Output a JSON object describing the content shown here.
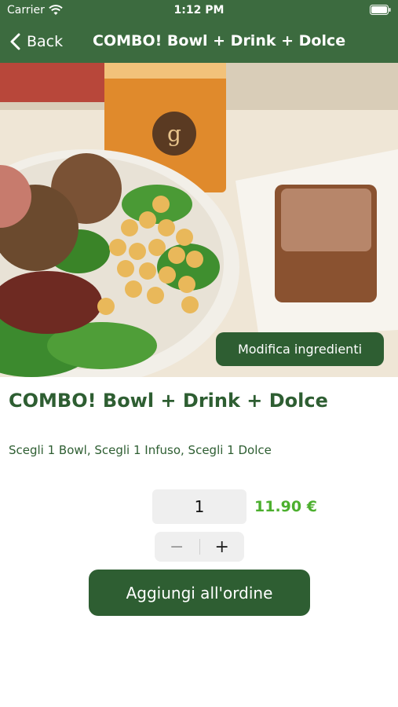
{
  "status_bar": {
    "carrier": "Carrier",
    "time": "1:12 PM",
    "wifi_icon": "wifi-icon",
    "battery_icon": "battery-icon"
  },
  "nav": {
    "back_label": "Back",
    "back_icon": "chevron-left-icon",
    "title": "COMBO! Bowl + Drink + Dolce"
  },
  "hero": {
    "image_subject": "bowl-drink-dessert-photo",
    "edit_button_label": "Modifica ingredienti"
  },
  "product": {
    "title": "COMBO! Bowl + Drink + Dolce",
    "description": "Scegli 1 Bowl, Scegli 1 Infuso, Scegli 1 Dolce",
    "quantity": "1",
    "price": "11.90 €"
  },
  "stepper": {
    "minus_label": "−",
    "plus_label": "+"
  },
  "actions": {
    "add_label": "Aggiungi all'ordine"
  },
  "colors": {
    "brand_green": "#3c6b3f",
    "button_green": "#2e5e32",
    "price_green": "#4caf2e"
  }
}
